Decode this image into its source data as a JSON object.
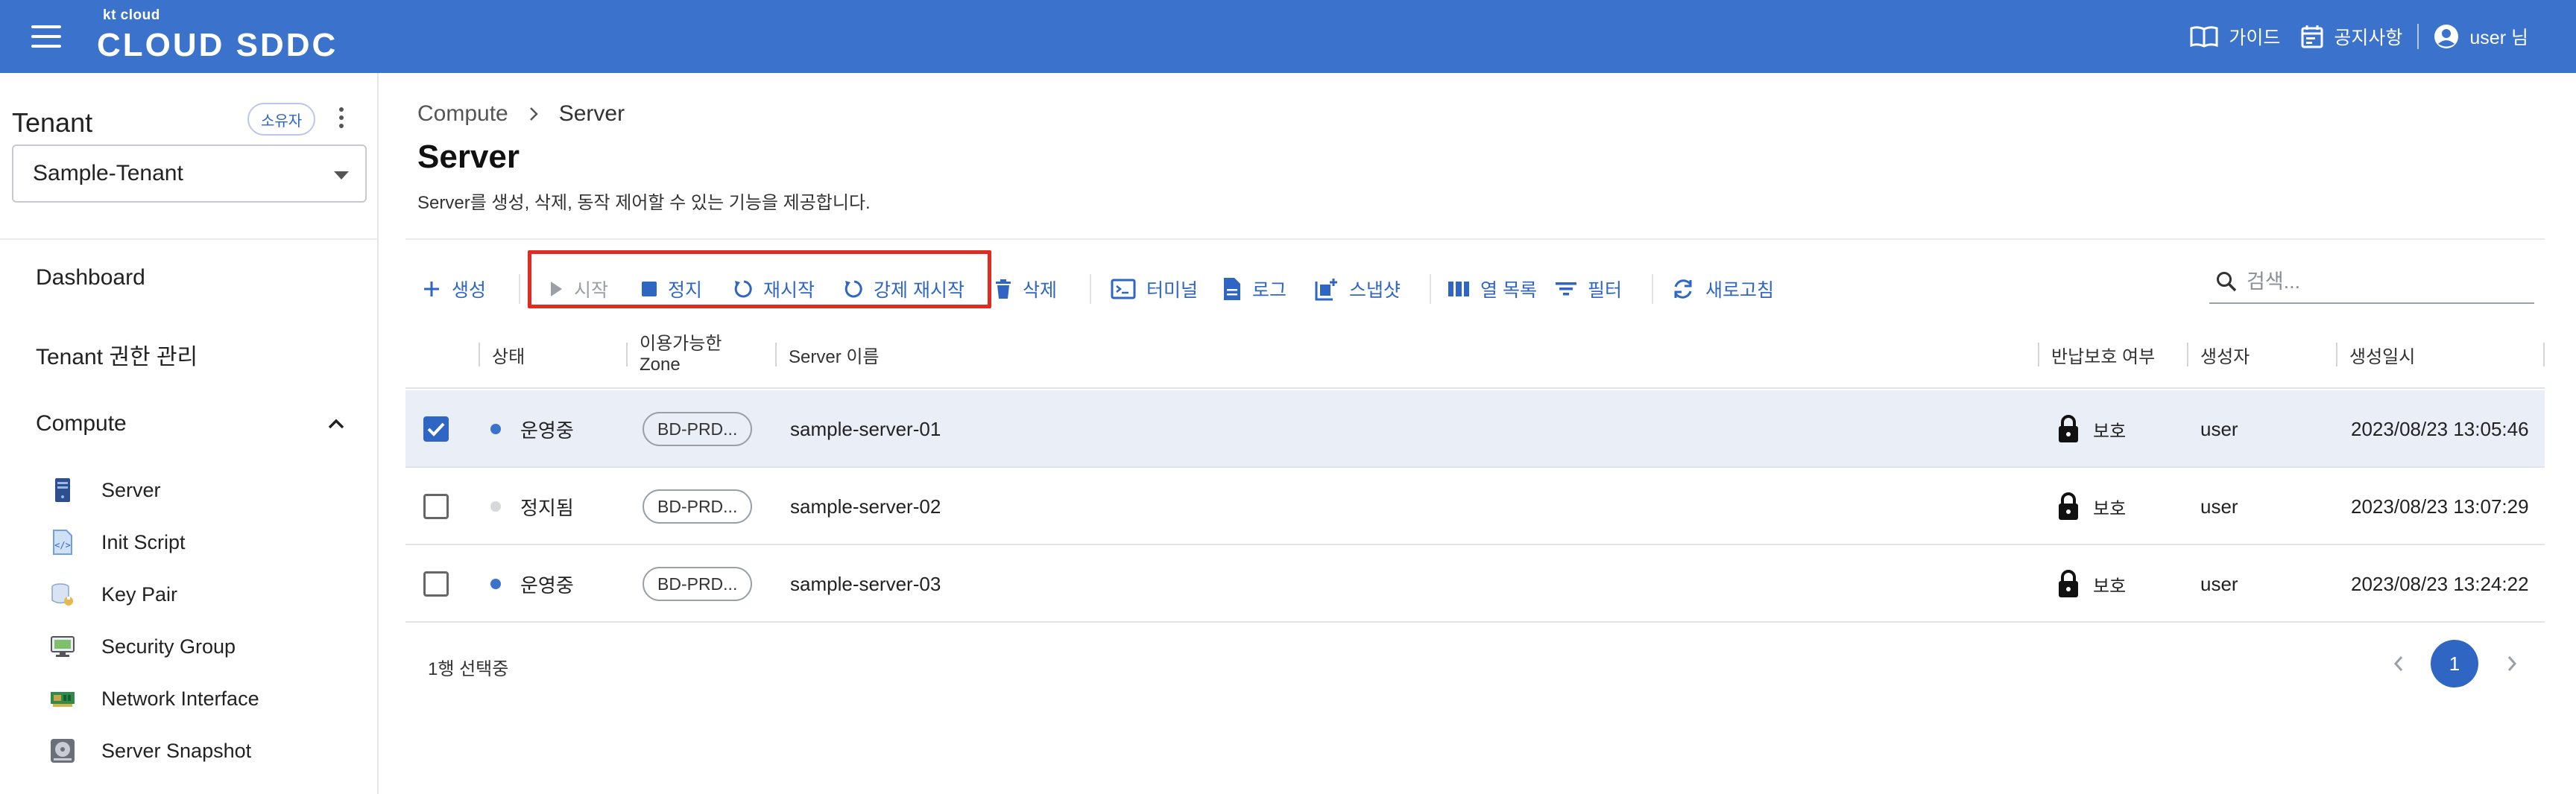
{
  "header": {
    "logo_small": "kt cloud",
    "logo_main": "CLOUD SDDC",
    "guide_label": "가이드",
    "notice_label": "공지사항",
    "user_label": "user 님"
  },
  "sidebar": {
    "tenant_title": "Tenant",
    "owner_badge": "소유자",
    "tenant_selected": "Sample-Tenant",
    "dashboard": "Dashboard",
    "tenant_permission": "Tenant 권한 관리",
    "compute": "Compute",
    "compute_items": [
      {
        "label": "Server",
        "icon": "server-icon"
      },
      {
        "label": "Init Script",
        "icon": "script-icon"
      },
      {
        "label": "Key Pair",
        "icon": "key-pair-icon"
      },
      {
        "label": "Security Group",
        "icon": "security-group-icon"
      },
      {
        "label": "Network Interface",
        "icon": "network-card-icon"
      },
      {
        "label": "Server Snapshot",
        "icon": "disk-snapshot-icon"
      }
    ]
  },
  "breadcrumb": {
    "parent": "Compute",
    "current": "Server"
  },
  "page": {
    "title": "Server",
    "description": "Server를 생성, 삭제, 동작 제어할 수 있는 기능을 제공합니다."
  },
  "toolbar": {
    "create": "생성",
    "start": "시작",
    "stop": "정지",
    "restart": "재시작",
    "force_restart": "강제 재시작",
    "delete": "삭제",
    "terminal": "터미널",
    "log": "로그",
    "snapshot": "스냅샷",
    "columns": "열 목록",
    "filter": "필터",
    "refresh": "새로고침",
    "search_placeholder": "검색..."
  },
  "table": {
    "headers": {
      "status": "상태",
      "zone_line1": "이용가능한",
      "zone_line2": "Zone",
      "name": "Server 이름",
      "protection": "반납보호 여부",
      "creator": "생성자",
      "created_at": "생성일시"
    },
    "rows": [
      {
        "checked": true,
        "status": "운영중",
        "status_color": "#3b73cc",
        "zone": "BD-PRD...",
        "name": "sample-server-01",
        "protection": "보호",
        "creator": "user",
        "created_at": "2023/08/23 13:05:46"
      },
      {
        "checked": false,
        "status": "정지됨",
        "status_color": "#d6d8dc",
        "zone": "BD-PRD...",
        "name": "sample-server-02",
        "protection": "보호",
        "creator": "user",
        "created_at": "2023/08/23 13:07:29"
      },
      {
        "checked": false,
        "status": "운영중",
        "status_color": "#3b73cc",
        "zone": "BD-PRD...",
        "name": "sample-server-03",
        "protection": "보호",
        "creator": "user",
        "created_at": "2023/08/23 13:24:22"
      }
    ]
  },
  "footer": {
    "selection": "1행 선택중",
    "page": "1"
  },
  "colors": {
    "brand": "#3b73cc",
    "accent": "#2f66c4",
    "highlight": "#e02a22"
  }
}
